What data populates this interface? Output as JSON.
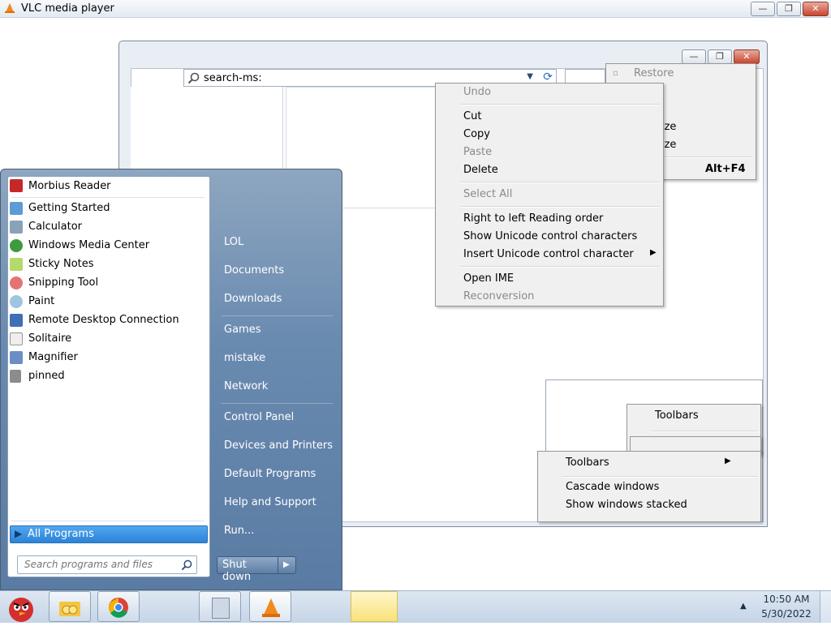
{
  "window": {
    "title": "VLC media player"
  },
  "titlebar_buttons": {
    "minimize": "—",
    "maximize": "❐",
    "close": "✕"
  },
  "search": {
    "value": "search-ms:"
  },
  "edit_menu": {
    "items": [
      {
        "label": "Undo",
        "disabled": true
      },
      {
        "label": "Cut",
        "disabled": false
      },
      {
        "label": "Copy",
        "disabled": false
      },
      {
        "label": "Paste",
        "disabled": true
      },
      {
        "label": "Delete",
        "disabled": false
      },
      {
        "label": "Select All",
        "disabled": true
      },
      {
        "label": "Right to left Reading order",
        "disabled": false
      },
      {
        "label": "Show Unicode control characters",
        "disabled": false
      },
      {
        "label": "Insert Unicode control character",
        "disabled": false
      },
      {
        "label": "Open IME",
        "disabled": false
      },
      {
        "label": "Reconversion",
        "disabled": true
      }
    ]
  },
  "system_menu": {
    "restore": "Restore",
    "size_partial_1": "ize",
    "size_partial_2": "ize",
    "close_shortcut": "Alt+F4"
  },
  "toolbars_menu_back": {
    "toolbars": "Toolbars"
  },
  "taskbar_menu": {
    "toolbars": "Toolbars",
    "cascade": "Cascade windows",
    "stacked": "Show windows stacked"
  },
  "start_menu": {
    "pinned": [
      "Morbius Reader",
      "Getting Started",
      "Calculator",
      "Windows Media Center",
      "Sticky Notes",
      "Snipping Tool",
      "Paint",
      "Remote Desktop Connection",
      "Solitaire",
      "Magnifier",
      "pinned"
    ],
    "all_programs": "All Programs",
    "search_placeholder": "Search programs and files",
    "places": [
      "LOL",
      "Documents",
      "Downloads",
      "Games",
      "mistake",
      "Network",
      "Control Panel",
      "Devices and Printers",
      "Default Programs",
      "Help and Support",
      "Run..."
    ],
    "shutdown": "Shut down"
  },
  "clock": {
    "time": "10:50 AM",
    "date": "5/30/2022"
  },
  "colors": {
    "start_menu": "#6a8bb0",
    "highlight": "#3a8ee0",
    "taskbar": "#c5d4e6"
  }
}
